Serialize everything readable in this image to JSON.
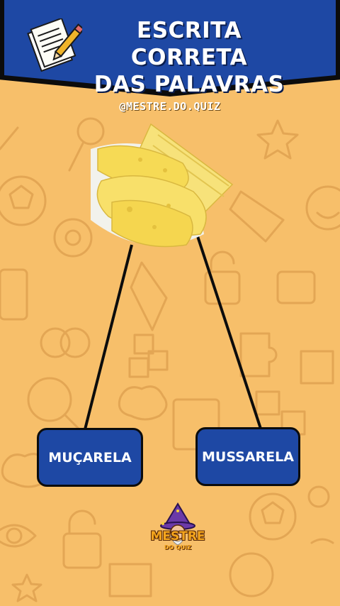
{
  "header": {
    "title_line1": "ESCRITA CORRETA",
    "title_line2": "DAS PALAVRAS",
    "icon": "paper-pencil-icon"
  },
  "handle": "@MESTRE.DO.QUIZ",
  "image": {
    "subject": "cheese-slices-icon"
  },
  "options": {
    "left": "MUÇARELA",
    "right": "MUSSARELA"
  },
  "logo": {
    "name": "MESTRE",
    "sub": "DO QUIZ",
    "icon": "wizard-mascot-icon"
  },
  "colors": {
    "background": "#f7bf6a",
    "banner": "#1e48a4",
    "button": "#1e48a4",
    "doodles": "#e3a654"
  }
}
